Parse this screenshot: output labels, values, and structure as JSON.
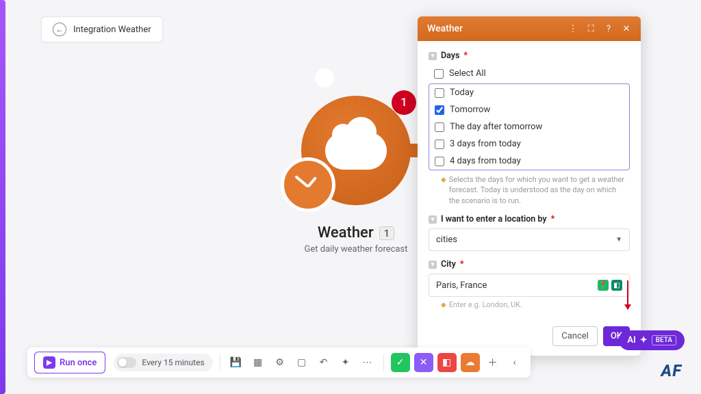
{
  "breadcrumb": {
    "label": "Integration Weather"
  },
  "node": {
    "title": "Weather",
    "count": "1",
    "subtitle": "Get daily weather forecast",
    "badge": "1"
  },
  "panel": {
    "title": "Weather",
    "days": {
      "label": "Days",
      "select_all": "Select All",
      "options": [
        {
          "label": "Today",
          "checked": false
        },
        {
          "label": "Tomorrow",
          "checked": true
        },
        {
          "label": "The day after tomorrow",
          "checked": false
        },
        {
          "label": "3 days from today",
          "checked": false
        },
        {
          "label": "4 days from today",
          "checked": false
        }
      ],
      "hint": "Selects the days for which you want to get a weather forecast. Today is understood as the day on which the scenario is to run."
    },
    "location_by": {
      "label": "I want to enter a location by",
      "value": "cities"
    },
    "city": {
      "label": "City",
      "value": "Paris, France",
      "hint": "Enter e.g. London, UK."
    },
    "cancel": "Cancel",
    "ok": "OK"
  },
  "toolbar": {
    "run": "Run once",
    "schedule": "Every 15 minutes"
  },
  "ai": {
    "label": "AI",
    "beta": "BETA"
  },
  "logo": "AF"
}
